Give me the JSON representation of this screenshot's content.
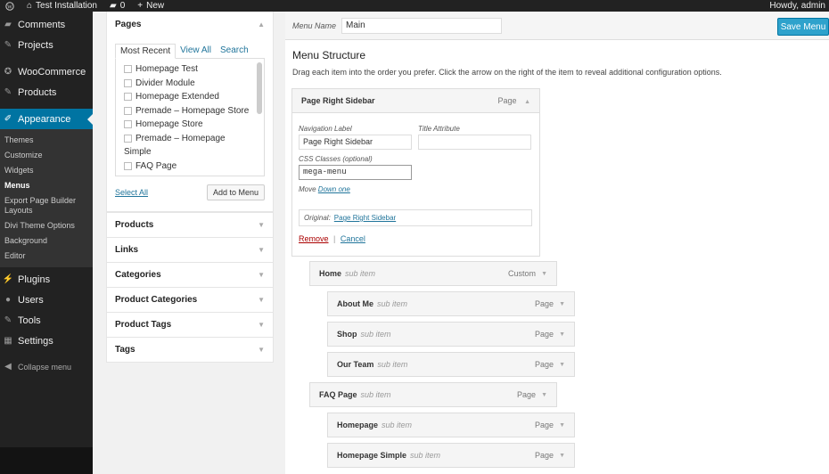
{
  "adminbar": {
    "site_name": "Test Installation",
    "comments_count": "0",
    "new_label": "New",
    "howdy": "Howdy, admin"
  },
  "sidebar": {
    "items_top": [
      {
        "label": "Comments",
        "icon": "comment-icon"
      },
      {
        "label": "Projects",
        "icon": "pin-icon"
      },
      {
        "label": "WooCommerce",
        "icon": "woo-icon"
      },
      {
        "label": "Products",
        "icon": "pin-icon"
      },
      {
        "label": "Appearance",
        "icon": "brush-icon"
      }
    ],
    "submenu": [
      "Themes",
      "Customize",
      "Widgets",
      "Menus",
      "Export Page Builder Layouts",
      "Divi Theme Options",
      "Background",
      "Editor"
    ],
    "items_bottom": [
      {
        "label": "Plugins",
        "icon": "plug-icon"
      },
      {
        "label": "Users",
        "icon": "user-icon"
      },
      {
        "label": "Tools",
        "icon": "wrench-icon"
      },
      {
        "label": "Settings",
        "icon": "settings-icon"
      }
    ],
    "collapse": "Collapse menu"
  },
  "pages_box": {
    "title": "Pages",
    "tabs": [
      "Most Recent",
      "View All",
      "Search"
    ],
    "items": [
      "Homepage Test",
      "Divider Module",
      "Homepage Extended",
      "Premade – Homepage Store",
      "Homepage Store",
      "Premade – Homepage",
      "Simple",
      "FAQ Page"
    ],
    "select_all": "Select All",
    "add_to_menu": "Add to Menu"
  },
  "accordion": [
    "Products",
    "Links",
    "Categories",
    "Product Categories",
    "Product Tags",
    "Tags"
  ],
  "menu": {
    "name_label": "Menu Name",
    "name_value": "Main",
    "save_label": "Save Menu",
    "structure_title": "Menu Structure",
    "structure_desc": "Drag each item into the order you prefer. Click the arrow on the right of the item to reveal additional configuration options.",
    "expanded": {
      "title": "Page Right Sidebar",
      "type": "Page",
      "nav_label_lbl": "Navigation Label",
      "nav_label_val": "Page Right Sidebar",
      "title_attr_lbl": "Title Attribute",
      "css_lbl": "CSS Classes (optional)",
      "css_val": "mega-menu",
      "move_lbl": "Move",
      "move_link": "Down one",
      "original_lbl": "Original:",
      "original_link": "Page Right Sidebar",
      "remove": "Remove",
      "cancel": "Cancel"
    },
    "items": [
      {
        "title": "Home",
        "sub": "sub item",
        "type": "Custom"
      },
      {
        "title": "About Me",
        "sub": "sub item",
        "type": "Page"
      },
      {
        "title": "Shop",
        "sub": "sub item",
        "type": "Page"
      },
      {
        "title": "Our Team",
        "sub": "sub item",
        "type": "Page"
      },
      {
        "title": "FAQ Page",
        "sub": "sub item",
        "type": "Page"
      },
      {
        "title": "Homepage",
        "sub": "sub item",
        "type": "Page"
      },
      {
        "title": "Homepage Simple",
        "sub": "sub item",
        "type": "Page"
      }
    ]
  }
}
